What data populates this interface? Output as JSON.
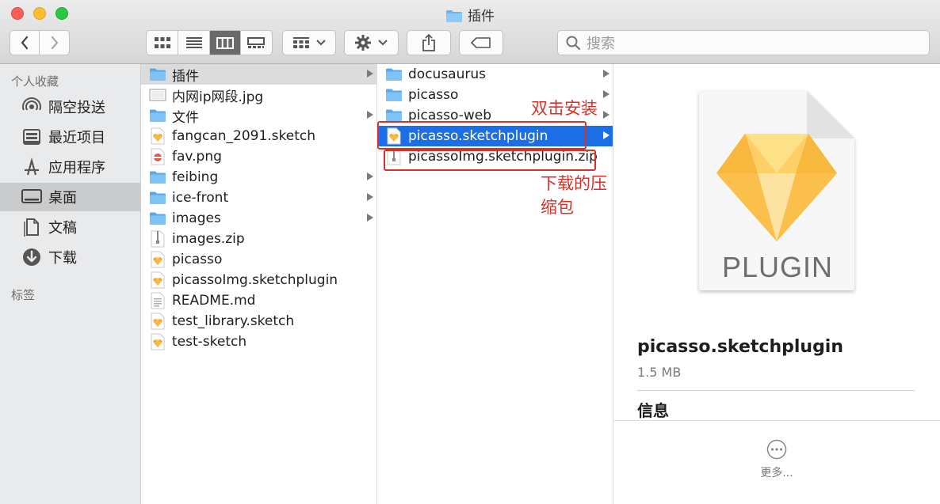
{
  "window": {
    "title": "插件"
  },
  "toolbar": {
    "back_label": "‹",
    "forward_label": "›",
    "search_placeholder": "搜索"
  },
  "sidebar": {
    "favorites_header": "个人收藏",
    "items": [
      {
        "label": "隔空投送",
        "icon": "airdrop-icon"
      },
      {
        "label": "最近项目",
        "icon": "recents-icon"
      },
      {
        "label": "应用程序",
        "icon": "applications-icon"
      },
      {
        "label": "桌面",
        "icon": "desktop-icon",
        "selected": true
      },
      {
        "label": "文稿",
        "icon": "documents-icon"
      },
      {
        "label": "下载",
        "icon": "downloads-icon"
      }
    ],
    "tags_header": "标签"
  },
  "column1": {
    "items": [
      {
        "name": "插件",
        "type": "folder",
        "has_children": true,
        "selected": true
      },
      {
        "name": "内网ip网段.jpg",
        "type": "image"
      },
      {
        "name": "文件",
        "type": "folder",
        "has_children": true
      },
      {
        "name": "fangcan_2091.sketch",
        "type": "sketch"
      },
      {
        "name": "fav.png",
        "type": "png"
      },
      {
        "name": "feibing",
        "type": "folder",
        "has_children": true
      },
      {
        "name": "ice-front",
        "type": "folder",
        "has_children": true
      },
      {
        "name": "images",
        "type": "folder",
        "has_children": true
      },
      {
        "name": "images.zip",
        "type": "zip"
      },
      {
        "name": "picasso",
        "type": "sketch"
      },
      {
        "name": "picassoImg.sketchplugin",
        "type": "sketch"
      },
      {
        "name": "README.md",
        "type": "text"
      },
      {
        "name": "test_library.sketch",
        "type": "sketch"
      },
      {
        "name": "test-sketch",
        "type": "sketch"
      }
    ]
  },
  "column2": {
    "items": [
      {
        "name": "docusaurus",
        "type": "folder",
        "has_children": true
      },
      {
        "name": "picasso",
        "type": "folder",
        "has_children": true
      },
      {
        "name": "picasso-web",
        "type": "folder",
        "has_children": true
      },
      {
        "name": "picasso.sketchplugin",
        "type": "sketch",
        "selected": true
      },
      {
        "name": "picassoImg.sketchplugin.zip",
        "type": "zip"
      }
    ]
  },
  "annotations": {
    "install": "双击安装",
    "zip": "下载的压缩包"
  },
  "preview": {
    "badge": "PLUGIN",
    "name": "picasso.sketchplugin",
    "size": "1.5 MB",
    "info_header": "信息",
    "more_label": "更多..."
  },
  "colors": {
    "selection_blue": "#1b6ee6",
    "annotation_red": "#d8312a",
    "folder_blue": "#6bb6ef",
    "sketch_orange": "#f5a623"
  }
}
